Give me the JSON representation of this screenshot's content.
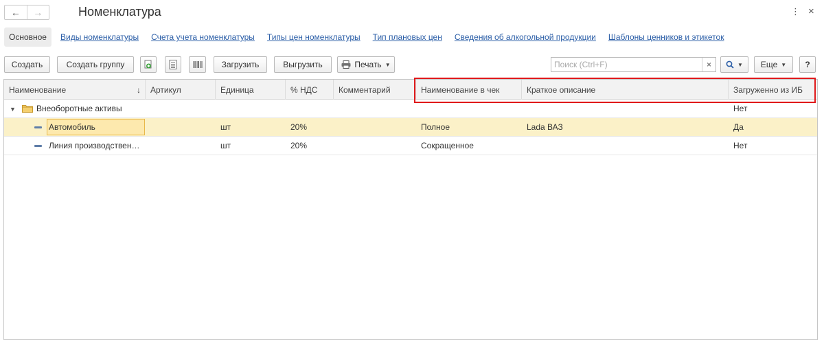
{
  "window": {
    "title": "Номенклатура",
    "more_glyph": "⋮",
    "close_glyph": "×"
  },
  "tabs": {
    "main": "Основное",
    "links": [
      "Виды номенклатуры",
      "Счета учета номенклатуры",
      "Типы цен номенклатуры",
      "Тип плановых цен",
      "Сведения об алкогольной продукции",
      "Шаблоны ценников и этикеток"
    ]
  },
  "toolbar": {
    "create": "Создать",
    "create_group": "Создать группу",
    "load": "Загрузить",
    "unload": "Выгрузить",
    "print": "Печать",
    "search_placeholder": "Поиск (Ctrl+F)",
    "clear": "×",
    "more": "Еще",
    "help": "?"
  },
  "table": {
    "columns": [
      "Наименование",
      "Артикул",
      "Единица",
      "% НДС",
      "Комментарий",
      "Наименование в чек",
      "Краткое описание",
      "Загруженно из ИБ"
    ],
    "sort_indicator": "↓",
    "rows": [
      {
        "name": "Внеоборотные активы",
        "type": "group",
        "article": "",
        "unit": "",
        "vat": "",
        "comment": "",
        "check_name": "",
        "short_desc": "",
        "loaded": "Нет"
      },
      {
        "name": "Автомобиль",
        "type": "item",
        "article": "",
        "unit": "шт",
        "vat": "20%",
        "comment": "",
        "check_name": "Полное",
        "short_desc": "Lada ВАЗ",
        "loaded": "Да"
      },
      {
        "name": "Линия производствен…",
        "type": "item",
        "article": "",
        "unit": "шт",
        "vat": "20%",
        "comment": "",
        "check_name": "Сокращенное",
        "short_desc": "",
        "loaded": "Нет"
      }
    ]
  },
  "colors": {
    "link": "#2b5ea7",
    "selected_row": "#fbf1c8",
    "focus_cell": "#fde9ae",
    "highlight": "#e0191b",
    "folder": "#f2c45a"
  }
}
